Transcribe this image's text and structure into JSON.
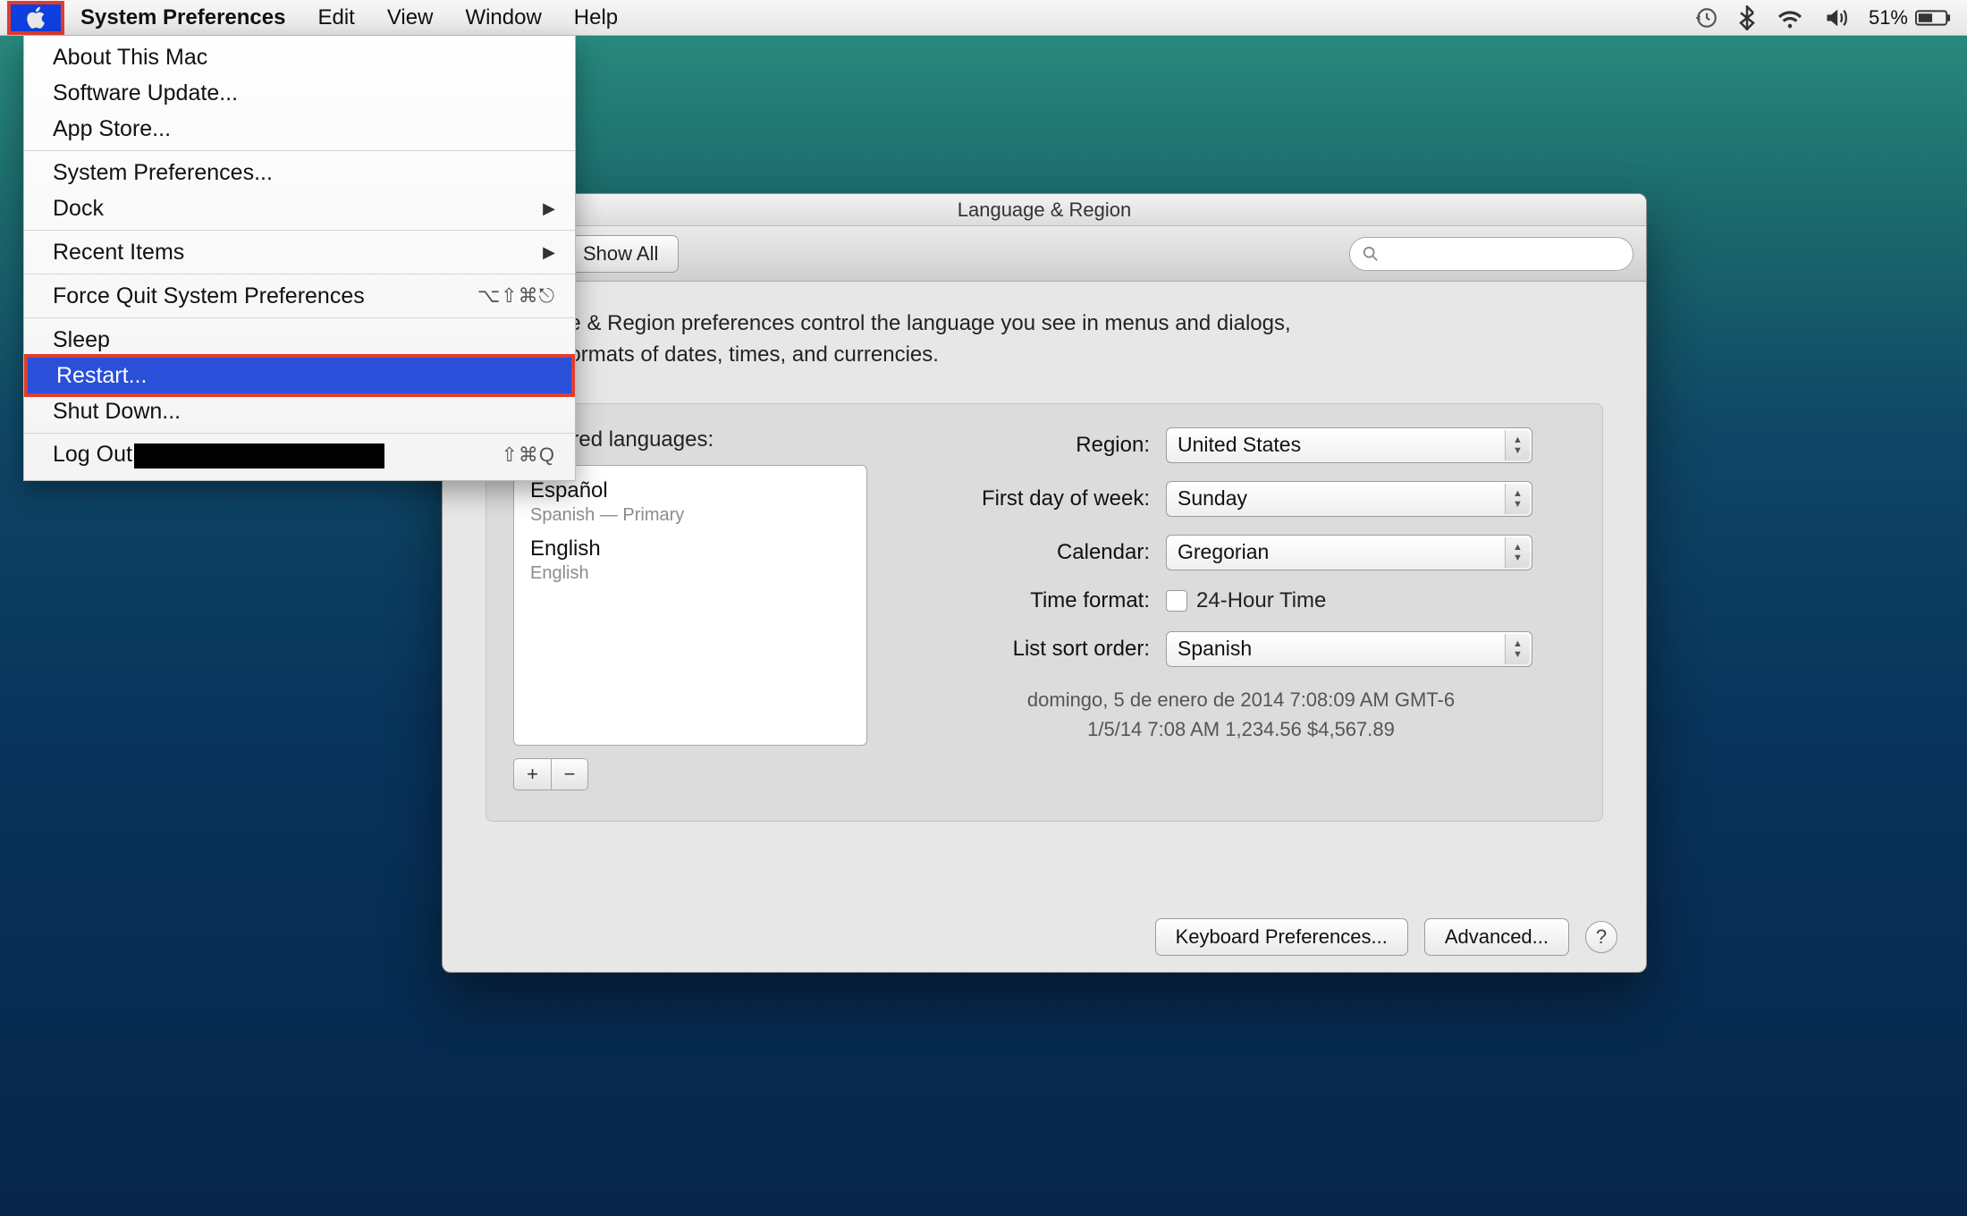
{
  "menubar": {
    "app": "System Preferences",
    "items": [
      "Edit",
      "View",
      "Window",
      "Help"
    ],
    "battery_pct": "51%"
  },
  "apple_menu": {
    "about": "About This Mac",
    "software_update": "Software Update...",
    "app_store": "App Store...",
    "sys_prefs": "System Preferences...",
    "dock": "Dock",
    "recent": "Recent Items",
    "force_quit": "Force Quit System Preferences",
    "force_quit_shortcut": "⌥⇧⌘⎋",
    "sleep": "Sleep",
    "restart": "Restart...",
    "shutdown": "Shut Down...",
    "logout_prefix": "Log Out",
    "logout_shortcut": "⇧⌘Q"
  },
  "window": {
    "title": "Language & Region",
    "show_all": "Show All",
    "desc_l1": "Language & Region preferences control the language you see in menus and dialogs,",
    "desc_l2": "and the formats of dates, times, and currencies.",
    "pref_label": "Preferred languages:",
    "languages": [
      {
        "name": "Español",
        "sub": "Spanish — Primary"
      },
      {
        "name": "English",
        "sub": "English"
      }
    ],
    "fields": {
      "region_label": "Region:",
      "region_value": "United States",
      "first_day_label": "First day of week:",
      "first_day_value": "Sunday",
      "calendar_label": "Calendar:",
      "calendar_value": "Gregorian",
      "time_label": "Time format:",
      "time_checkbox": "24-Hour Time",
      "sort_label": "List sort order:",
      "sort_value": "Spanish"
    },
    "sample_l1": "domingo, 5 de enero de 2014 7:08:09 AM GMT-6",
    "sample_l2": "1/5/14 7:08 AM    1,234.56    $4,567.89",
    "keyboard_btn": "Keyboard Preferences...",
    "advanced_btn": "Advanced...",
    "help": "?"
  }
}
